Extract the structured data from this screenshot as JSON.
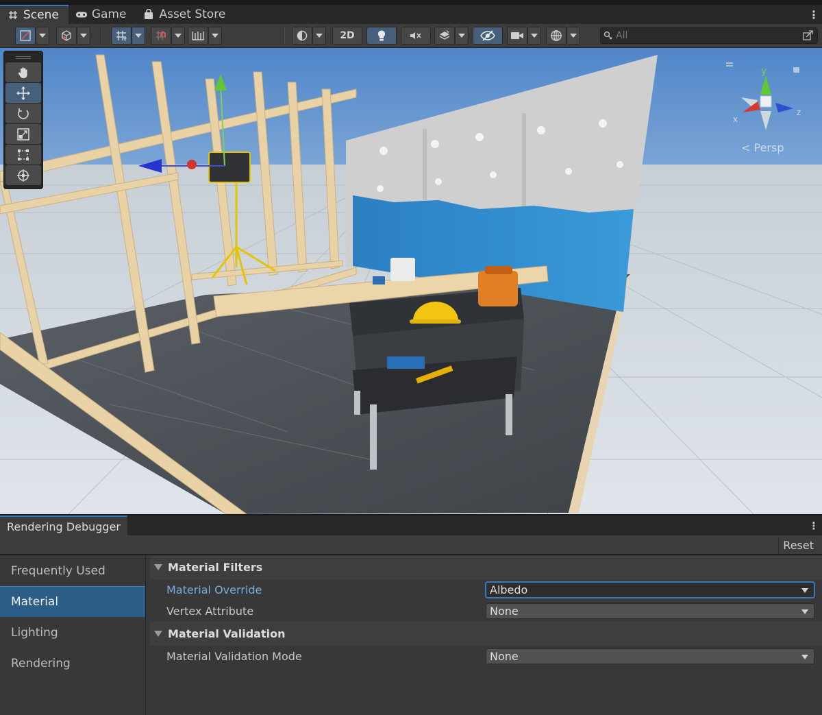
{
  "tabs": [
    {
      "label": "Scene",
      "icon": "grid-icon",
      "active": true
    },
    {
      "label": "Game",
      "icon": "gamepad-icon",
      "active": false
    },
    {
      "label": "Asset Store",
      "icon": "shopping-bag-icon",
      "active": false
    }
  ],
  "scene_toolbar": {
    "mode_2d_label": "2D",
    "search_placeholder": "All"
  },
  "scene": {
    "view_label": "Persp",
    "gizmo_axes": {
      "x": "x",
      "y": "y",
      "z": "z"
    }
  },
  "debugger": {
    "title": "Rendering Debugger",
    "reset_label": "Reset",
    "sidebar": [
      {
        "label": "Frequently Used",
        "active": false
      },
      {
        "label": "Material",
        "active": true
      },
      {
        "label": "Lighting",
        "active": false
      },
      {
        "label": "Rendering",
        "active": false
      }
    ],
    "sections": {
      "filters": {
        "title": "Material Filters",
        "material_override": {
          "label": "Material Override",
          "value": "Albedo"
        },
        "vertex_attribute": {
          "label": "Vertex Attribute",
          "value": "None"
        }
      },
      "validation": {
        "title": "Material Validation",
        "validation_mode": {
          "label": "Material Validation Mode",
          "value": "None"
        }
      }
    }
  },
  "colors": {
    "accent": "#3a79bb",
    "active_item": "#2c5d87",
    "highlight_label": "#7aacdc"
  }
}
